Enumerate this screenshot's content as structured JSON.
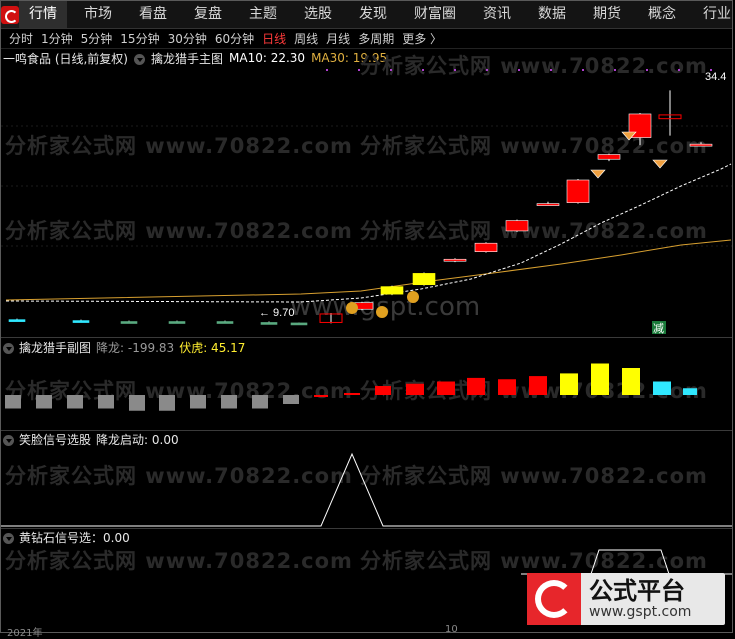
{
  "nav": {
    "items": [
      "行情",
      "市场",
      "看盘",
      "复盘",
      "主题",
      "选股",
      "发现",
      "财富圈",
      "资讯",
      "数据",
      "期货",
      "概念",
      "行业"
    ],
    "active_index": 0
  },
  "periods": {
    "items": [
      "分时",
      "1分钟",
      "5分钟",
      "15分钟",
      "30分钟",
      "60分钟",
      "日线",
      "周线",
      "月线",
      "多周期",
      "更多 〉"
    ],
    "active_index": 6
  },
  "main_panel": {
    "stock": "一鸣食品 (日线,前复权)",
    "indicator": "擒龙猎手主图",
    "ma10_label": "MA10: 22.30",
    "ma30_label": "MA30: 19.95",
    "high_label": "34.4",
    "low_label": "← 9.70",
    "signal_label": "减"
  },
  "sub_panel1": {
    "title": "擒龙猎手副图",
    "v1": "降龙: -199.83",
    "v2": "伏虎: 45.17"
  },
  "sub_panel2": {
    "title": "笑脸信号选股",
    "v1": "降龙启动: 0.00"
  },
  "sub_panel3": {
    "title": "黄钻石信号选：0.00"
  },
  "watermarks": {
    "text1": "分析家公式网 www.70822.com",
    "text2": "www.gspt.com"
  },
  "badge": {
    "title": "公式平台",
    "url": "www.gspt.com"
  },
  "bottom": {
    "left": "2021年",
    "mid": "10"
  },
  "colors": {
    "up": "#ff0000",
    "yellow": "#ffff00",
    "cyan": "#30e8ff",
    "down_gray": "#8a8a8a",
    "ma30": "#d8a030",
    "ma10": "#ffffff",
    "accent_active": "#ff3a3a"
  },
  "chart_data": [
    {
      "type": "candlestick",
      "title": "擒龙猎手主图",
      "candles": [
        {
          "o": 10.1,
          "h": 10.2,
          "l": 9.9,
          "c": 10.0,
          "kind": "cyan"
        },
        {
          "o": 10.0,
          "h": 10.1,
          "l": 9.8,
          "c": 9.9,
          "kind": "cyan"
        },
        {
          "o": 9.9,
          "h": 10.0,
          "l": 9.75,
          "c": 9.85,
          "kind": "green"
        },
        {
          "o": 9.9,
          "h": 10.0,
          "l": 9.8,
          "c": 9.9,
          "kind": "green"
        },
        {
          "o": 9.9,
          "h": 10.0,
          "l": 9.75,
          "c": 9.8,
          "kind": "green"
        },
        {
          "o": 9.8,
          "h": 9.9,
          "l": 9.7,
          "c": 9.75,
          "kind": "green"
        },
        {
          "o": 9.75,
          "h": 9.8,
          "l": 9.7,
          "c": 9.72,
          "kind": "green"
        },
        {
          "o": 9.8,
          "h": 10.8,
          "l": 9.7,
          "c": 10.7,
          "kind": "hollow"
        },
        {
          "o": 11.2,
          "h": 12.0,
          "l": 11.1,
          "c": 11.9,
          "kind": "red"
        },
        {
          "o": 12.8,
          "h": 13.7,
          "l": 12.7,
          "c": 13.6,
          "kind": "yellow"
        },
        {
          "o": 13.8,
          "h": 15.1,
          "l": 13.7,
          "c": 15.0,
          "kind": "yellow"
        },
        {
          "o": 16.3,
          "h": 16.6,
          "l": 16.2,
          "c": 16.5,
          "kind": "red"
        },
        {
          "o": 17.3,
          "h": 18.3,
          "l": 17.2,
          "c": 18.2,
          "kind": "red"
        },
        {
          "o": 19.5,
          "h": 20.7,
          "l": 19.4,
          "c": 20.6,
          "kind": "red"
        },
        {
          "o": 22.4,
          "h": 22.6,
          "l": 22.2,
          "c": 22.4,
          "kind": "red"
        },
        {
          "o": 22.5,
          "h": 25.0,
          "l": 22.4,
          "c": 24.9,
          "kind": "red"
        },
        {
          "o": 27.1,
          "h": 27.7,
          "l": 26.9,
          "c": 27.6,
          "kind": "red"
        },
        {
          "o": 29.4,
          "h": 32.0,
          "l": 28.6,
          "c": 31.9,
          "kind": "red"
        },
        {
          "o": 31.4,
          "h": 34.4,
          "l": 29.6,
          "c": 31.8,
          "kind": "hollow"
        },
        {
          "o": 28.7,
          "h": 28.9,
          "l": 28.5,
          "c": 28.7,
          "kind": "red"
        }
      ],
      "ma10_label": "MA10: 22.30",
      "ma30_label": "MA30: 19.95"
    },
    {
      "type": "bar",
      "title": "擒龙猎手副图",
      "values": [
        -30,
        -30,
        -30,
        -30,
        -35,
        -35,
        -30,
        -30,
        -30,
        -20,
        -5,
        15,
        20,
        25,
        30,
        38,
        35,
        42,
        48,
        70,
        60,
        30,
        15
      ],
      "kinds": [
        "gray",
        "gray",
        "gray",
        "gray",
        "gray",
        "gray",
        "gray",
        "gray",
        "gray",
        "gray",
        "red",
        "red",
        "red",
        "red",
        "red",
        "red",
        "red",
        "red",
        "yellow",
        "yellow",
        "yellow",
        "cyan",
        "cyan"
      ]
    },
    {
      "type": "line",
      "title": "笑脸信号选股",
      "values": [
        0,
        0,
        0,
        0,
        0,
        0,
        0,
        0,
        0,
        0,
        0,
        1,
        0,
        0,
        0,
        0,
        0,
        0,
        0,
        0,
        0,
        0,
        0,
        0
      ]
    },
    {
      "type": "line",
      "title": "黄钻石信号选",
      "values": [
        0,
        0,
        0,
        0,
        0,
        0,
        0,
        0,
        0,
        0,
        0,
        0,
        0,
        0,
        0,
        0,
        0,
        0,
        0,
        1,
        1,
        0
      ]
    }
  ]
}
